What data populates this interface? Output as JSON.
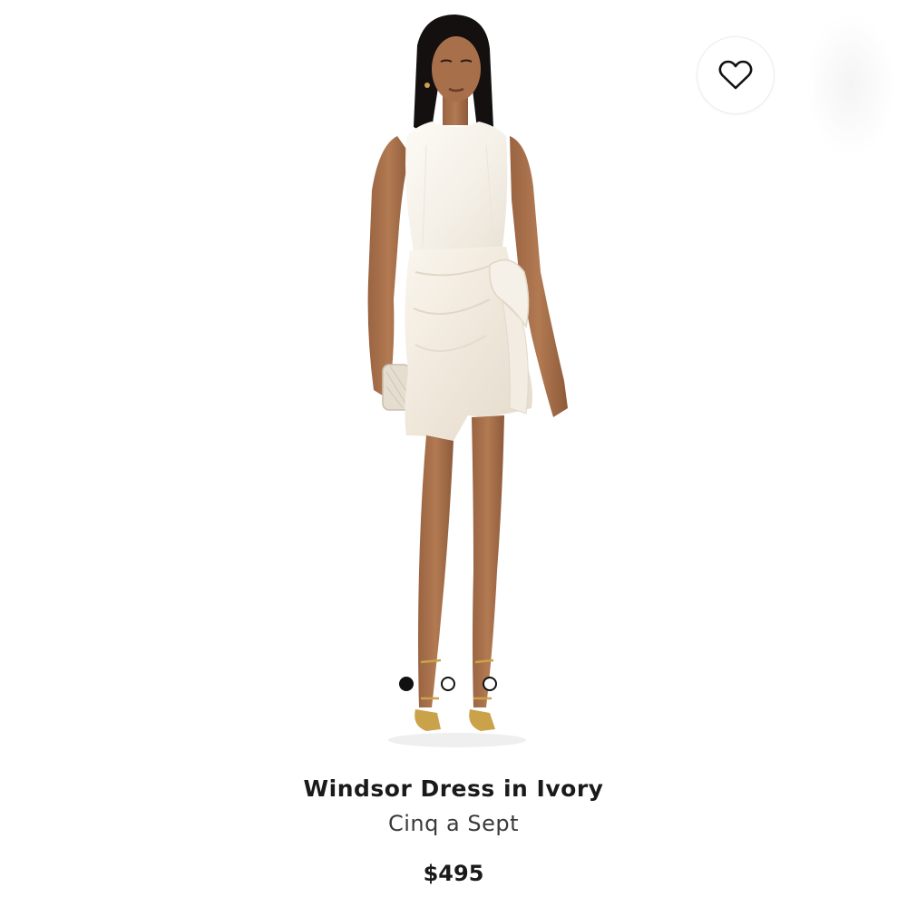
{
  "product": {
    "name": "Windsor Dress in Ivory",
    "brand": "Cinq a Sept",
    "price": "$495",
    "image_alt": "Model wearing white sleeveless mini dress with tie-front skirt, holding a clutch"
  },
  "carousel": {
    "total": 3,
    "active_index": 0
  },
  "wishlist": {
    "icon": "heart-outline-icon",
    "saved": false
  },
  "colors": {
    "text": "#1a1a1a",
    "dot": "#111111",
    "background": "#ffffff"
  }
}
